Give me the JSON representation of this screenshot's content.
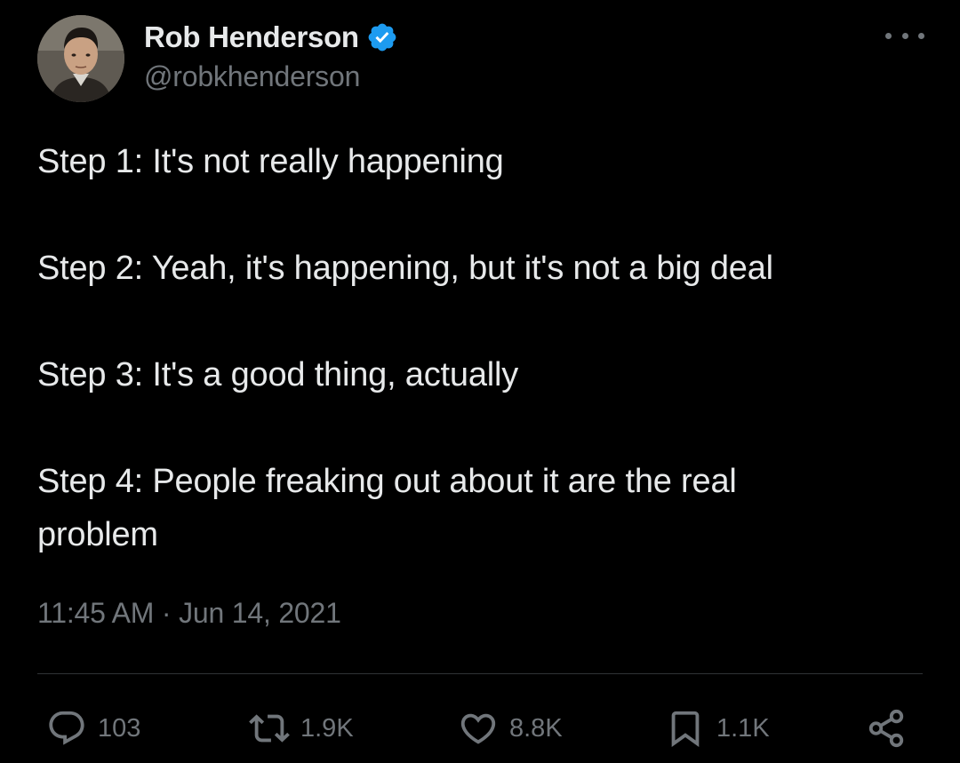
{
  "author": {
    "display_name": "Rob Henderson",
    "handle": "@robkhenderson",
    "verified": true,
    "avatar_icon": "profile-photo"
  },
  "tweet": {
    "lines": [
      "Step 1: It's not really happening",
      "Step 2: Yeah, it's happening, but it's not a big deal",
      "Step 3: It's a good thing, actually",
      "Step 4: People freaking out about it are the real problem"
    ],
    "timestamp": "11:45 AM · Jun 14, 2021"
  },
  "actions": {
    "replies": "103",
    "retweets": "1.9K",
    "likes": "8.8K",
    "bookmarks": "1.1K"
  },
  "icons": {
    "more": "more-horizontal-icon",
    "verified": "verified-badge-icon",
    "reply": "reply-icon",
    "retweet": "retweet-icon",
    "like": "heart-icon",
    "bookmark": "bookmark-icon",
    "share": "share-icon"
  },
  "colors": {
    "background": "#000000",
    "text_primary": "#e7e9ea",
    "text_secondary": "#71767b",
    "verified_blue": "#1d9bf0",
    "divider": "#2f3336"
  }
}
